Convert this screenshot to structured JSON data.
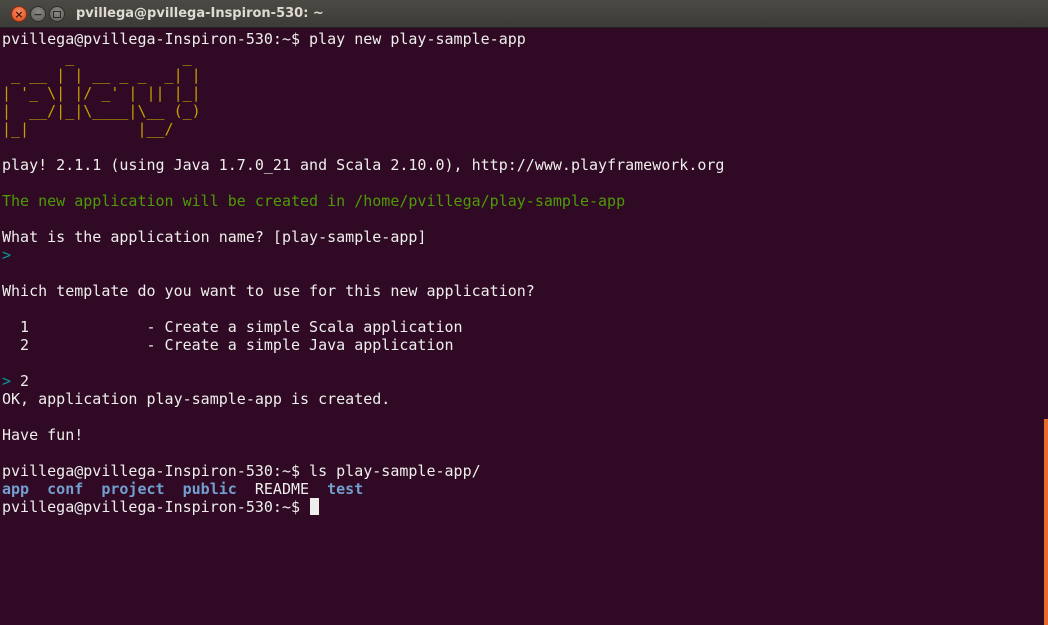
{
  "window": {
    "title": "pvillega@pvillega-Inspiron-530: ~",
    "close_symbol": "×",
    "min_symbol": "−"
  },
  "terminal": {
    "lines": [
      {
        "text": "pvillega@pvillega-Inspiron-530:~$ play new play-sample-app"
      },
      {
        "text": "       _            _"
      },
      {
        "text": " _ __ | | __ _ _  _| |"
      },
      {
        "text": "| '_ \\| |/ _' | || |_|"
      },
      {
        "text": "|  __/|_|\\____|\\__ (_)"
      },
      {
        "text": "|_|            |__/"
      },
      {
        "text": ""
      },
      {
        "text": "play! 2.1.1 (using Java 1.7.0_21 and Scala 2.10.0), http://www.playframework.org"
      },
      {
        "text": ""
      },
      {
        "text": "The new application will be created in /home/pvillega/play-sample-app"
      },
      {
        "text": ""
      },
      {
        "text": "What is the application name? [play-sample-app]"
      },
      {
        "text": ">"
      },
      {
        "text": ""
      },
      {
        "text": "Which template do you want to use for this new application?"
      },
      {
        "text": ""
      },
      {
        "text": "  1             - Create a simple Scala application"
      },
      {
        "text": "  2             - Create a simple Java application"
      },
      {
        "text": ""
      },
      {
        "prompt_char": ">",
        "input": " 2"
      },
      {
        "text": "OK, application play-sample-app is created."
      },
      {
        "text": ""
      },
      {
        "text": "Have fun!"
      },
      {
        "text": ""
      },
      {
        "text": "pvillega@pvillega-Inspiron-530:~$ ls play-sample-app/"
      }
    ],
    "ls_output": {
      "app": "app",
      "conf": "conf",
      "project": "project",
      "public": "public",
      "readme": "README",
      "test": "test"
    },
    "final_prompt": "pvillega@pvillega-Inspiron-530:~$ "
  },
  "colors": {
    "background": "#300a24",
    "foreground": "#eeeeec",
    "green": "#4e9a06",
    "cyan": "#06989a",
    "logo_yellow": "#c4a000",
    "directory_blue": "#729fcf",
    "scrollbar_orange": "#e46d2e"
  }
}
